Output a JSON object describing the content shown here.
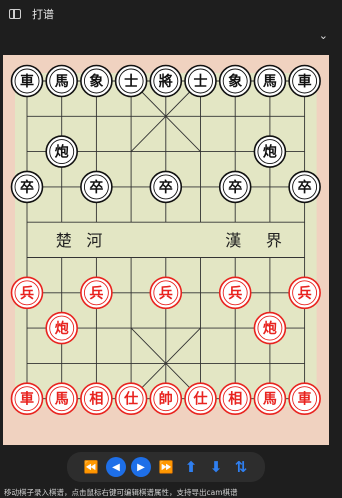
{
  "window": {
    "title": "打谱"
  },
  "board": {
    "river_left": [
      "楚",
      "河"
    ],
    "river_right": [
      "漢",
      "界"
    ],
    "black_back": [
      "車",
      "馬",
      "象",
      "士",
      "將",
      "士",
      "象",
      "馬",
      "車"
    ],
    "black_cannon": "炮",
    "black_pawn": "卒",
    "red_back": [
      "車",
      "馬",
      "相",
      "仕",
      "帥",
      "仕",
      "相",
      "馬",
      "車"
    ],
    "red_cannon": "炮",
    "red_pawn": "兵",
    "colors": {
      "red": "#e8231f",
      "black": "#111111",
      "board": "#e3e6c4",
      "frame": "#f0d2c0"
    }
  },
  "controls": {
    "first": "⏪",
    "prev": "◀",
    "next": "▶",
    "last": "⏩",
    "up": "⬆",
    "down": "⬇",
    "flip": "⇅"
  },
  "status_text": "移动棋子录入棋谱，点击鼠标右键可编辑棋谱属性，支持导出cam棋谱"
}
